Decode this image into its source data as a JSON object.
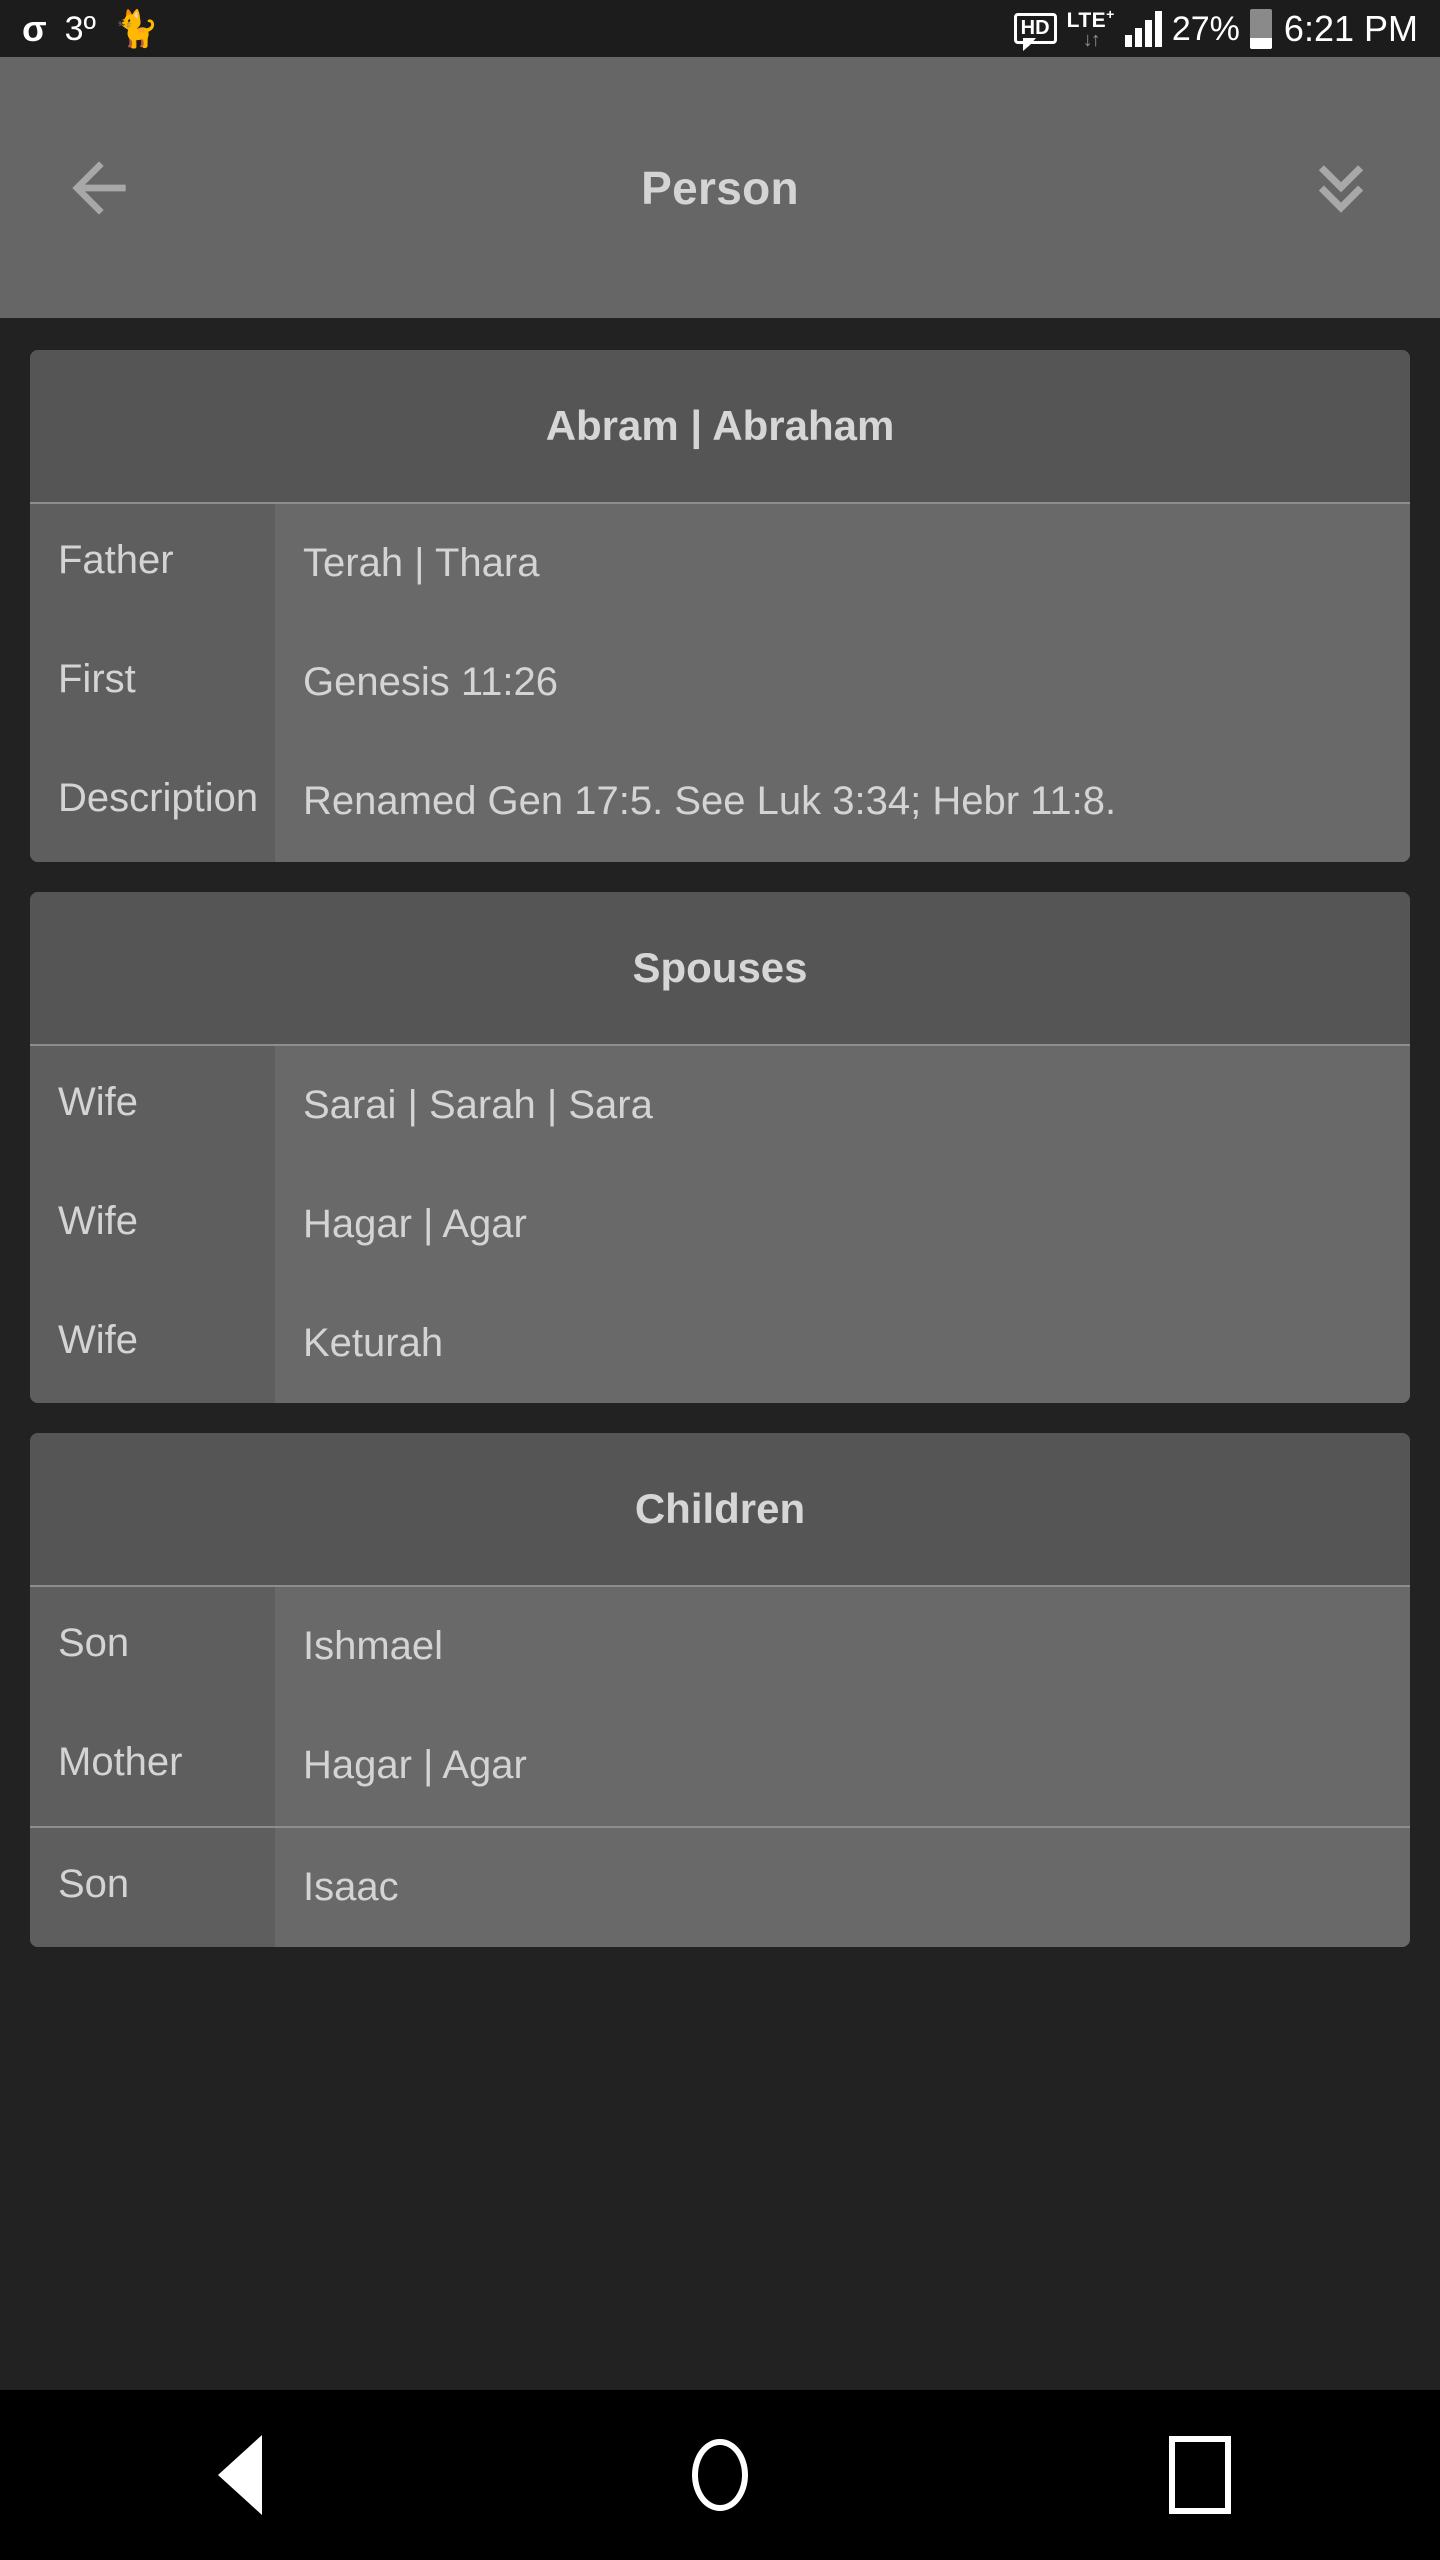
{
  "status_bar": {
    "app_glyph": "σ",
    "temperature": "3º",
    "pet_icon": "cat-icon",
    "hd_label": "HD",
    "network_label": "LTE",
    "network_sup": "+",
    "data_arrows": "↓↑",
    "battery_percent": "27%",
    "time": "6:21 PM"
  },
  "app_bar": {
    "back_icon": "back-arrow-icon",
    "title": "Person",
    "expand_icon": "double-chevron-down-icon"
  },
  "cards": [
    {
      "title": "Abram | Abraham",
      "rows": [
        {
          "label": "Father",
          "value": "Terah | Thara",
          "separator": false
        },
        {
          "label": "First",
          "value": "Genesis 11:26",
          "separator": false
        },
        {
          "label": "Description",
          "value": "Renamed Gen 17:5. See Luk 3:34; Hebr 11:8.",
          "separator": false
        }
      ]
    },
    {
      "title": "Spouses",
      "rows": [
        {
          "label": "Wife",
          "value": "Sarai | Sarah | Sara",
          "separator": false
        },
        {
          "label": "Wife",
          "value": "Hagar | Agar",
          "separator": false
        },
        {
          "label": "Wife",
          "value": "Keturah",
          "separator": false
        }
      ]
    },
    {
      "title": "Children",
      "rows": [
        {
          "label": "Son",
          "value": "Ishmael",
          "separator": false
        },
        {
          "label": "Mother",
          "value": "Hagar | Agar",
          "separator": false
        },
        {
          "label": "Son",
          "value": "Isaac",
          "separator": true
        }
      ]
    }
  ],
  "nav_bar": {
    "back_label": "back-triangle-icon",
    "home_label": "home-circle-icon",
    "recents_label": "recents-square-icon"
  },
  "colors": {
    "status_bar_bg": "#1c1c1c",
    "app_bar_bg": "#666666",
    "page_bg": "#222222",
    "card_bg": "#666666",
    "card_header_bg": "#555555",
    "row_label_bg": "#5e5e5e",
    "row_value_bg": "#696969",
    "text_primary": "#d4d4d4",
    "divider": "#8d8d8d",
    "nav_bar_bg": "#000000"
  }
}
